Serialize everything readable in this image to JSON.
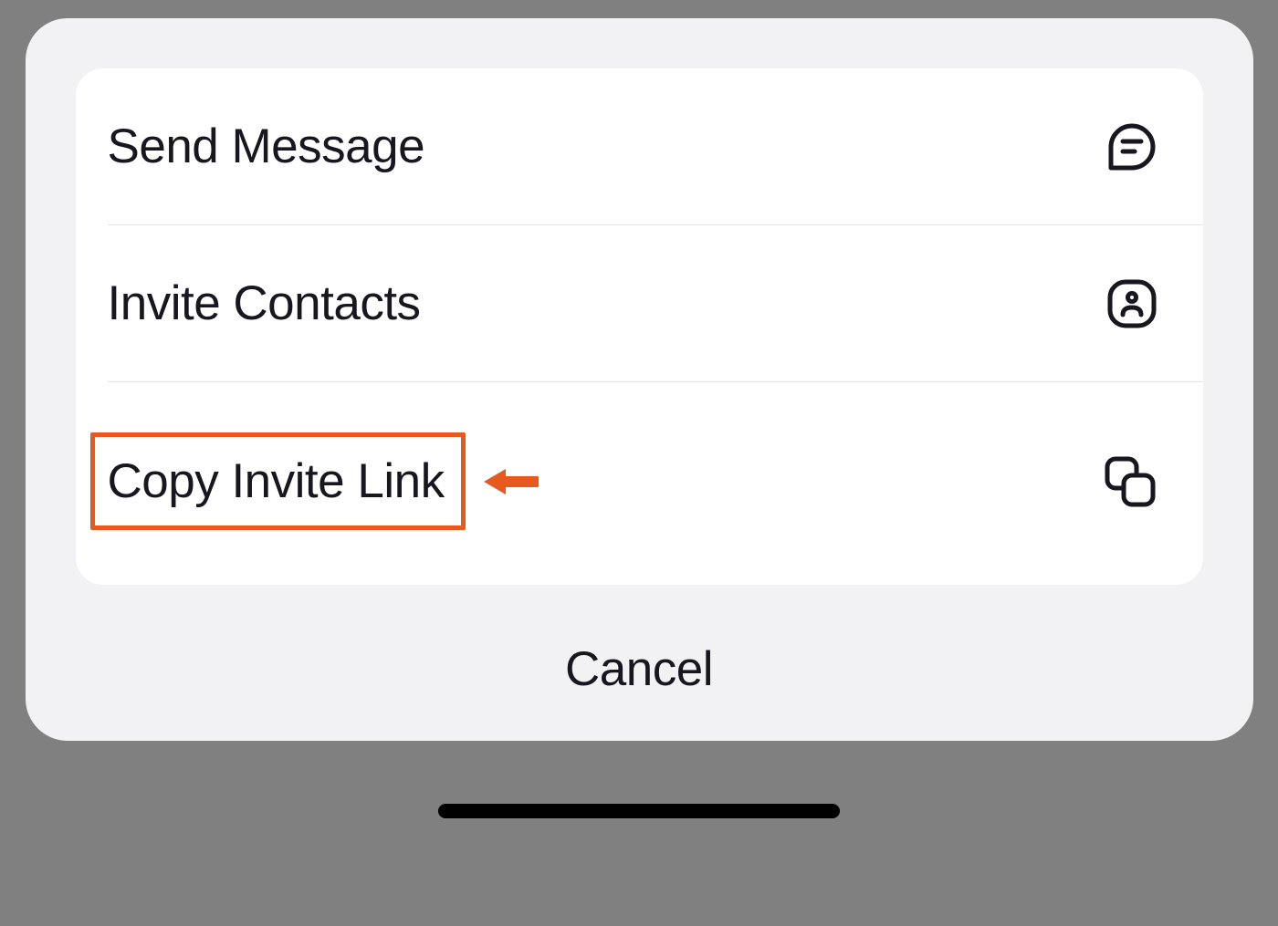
{
  "menu": {
    "items": [
      {
        "label": "Send Message",
        "icon": "chat"
      },
      {
        "label": "Invite Contacts",
        "icon": "person"
      },
      {
        "label": "Copy Invite Link",
        "icon": "copy",
        "highlighted": true
      }
    ]
  },
  "cancel": {
    "label": "Cancel"
  },
  "annotation": {
    "highlight_color": "#e8591f"
  }
}
